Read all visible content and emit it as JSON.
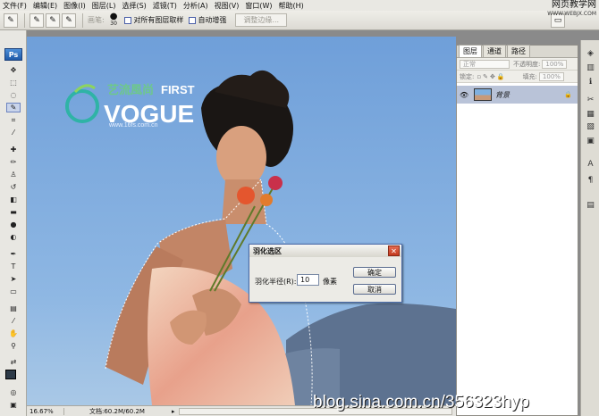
{
  "menu": [
    "文件(F)",
    "编辑(E)",
    "图像(I)",
    "图层(L)",
    "选择(S)",
    "滤镜(T)",
    "分析(A)",
    "视图(V)",
    "窗口(W)",
    "帮助(H)"
  ],
  "watermark": {
    "line1": "网页教学网",
    "line2": "WWW.WEBJX.COM"
  },
  "options": {
    "brush_label": "画笔:",
    "brush_size": "30",
    "sample_all_layers": "对所有图层取样",
    "auto_enhance": "自动增强",
    "refine_edge": "调整边缘..."
  },
  "toolbox": {
    "logo": "Ps"
  },
  "canvas_logo": {
    "brand_cn": "艺流風尚",
    "first": "FIRST",
    "vogue": "VOGUE",
    "site": "www.16fs.com.cn"
  },
  "blog_watermark": "blog.sina.com.cn/356323hyp",
  "status": {
    "zoom": "16.67%",
    "doc": "文档:60.2M/60.2M"
  },
  "layers": {
    "tabs": [
      "图层",
      "通道",
      "路径"
    ],
    "blend_mode": "正常",
    "opacity_label": "不透明度:",
    "opacity_value": "100%",
    "lock_label": "锁定:",
    "fill_label": "填充:",
    "fill_value": "100%",
    "layer_name": "背景"
  },
  "dialog": {
    "title": "羽化选区",
    "radius_label": "羽化半径(R):",
    "radius_value": "10",
    "unit": "像素",
    "ok": "确定",
    "cancel": "取消"
  }
}
